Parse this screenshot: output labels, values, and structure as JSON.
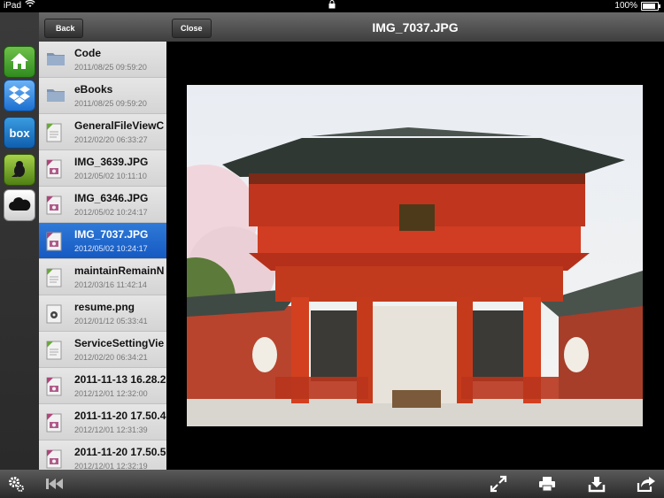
{
  "statusbar": {
    "device": "iPad",
    "battery_percent": "100%"
  },
  "sidebar": {
    "items": [
      {
        "name": "home",
        "icon": "home-icon"
      },
      {
        "name": "dropbox",
        "icon": "dropbox-icon"
      },
      {
        "name": "box",
        "label": "box",
        "icon": "box-icon"
      },
      {
        "name": "sugarsync",
        "icon": "sugarsync-icon"
      },
      {
        "name": "cloud",
        "icon": "cloud-icon"
      }
    ]
  },
  "filepanel": {
    "back_label": "Back",
    "files": [
      {
        "name": "Code",
        "date": "2011/08/25 09:59:20",
        "type": "folder"
      },
      {
        "name": "eBooks",
        "date": "2011/08/25 09:59:20",
        "type": "folder"
      },
      {
        "name": "GeneralFileViewC",
        "date": "2012/02/20 06:33:27",
        "type": "doc"
      },
      {
        "name": "IMG_3639.JPG",
        "date": "2012/05/02 10:11:10",
        "type": "image"
      },
      {
        "name": "IMG_6346.JPG",
        "date": "2012/05/02 10:24:17",
        "type": "image"
      },
      {
        "name": "IMG_7037.JPG",
        "date": "2012/05/02 10:24:17",
        "type": "image",
        "selected": true
      },
      {
        "name": "maintainRemainN",
        "date": "2012/03/16 11:42:14",
        "type": "doc"
      },
      {
        "name": "resume.png",
        "date": "2012/01/12 05:33:41",
        "type": "png"
      },
      {
        "name": "ServiceSettingVie",
        "date": "2012/02/20 06:34:21",
        "type": "doc"
      },
      {
        "name": "2011-11-13 16.28.2",
        "date": "2012/12/01 12:32:00",
        "type": "image"
      },
      {
        "name": "2011-11-20 17.50.4",
        "date": "2012/12/01 12:31:39",
        "type": "image"
      },
      {
        "name": "2011-11-20 17.50.5",
        "date": "2012/12/01 12:32:19",
        "type": "image"
      }
    ]
  },
  "viewer": {
    "close_label": "Close",
    "title": "IMG_7037.JPG"
  },
  "toolbar": {
    "icons": [
      "settings-icon",
      "rewind-icon",
      "fullscreen-icon",
      "print-icon",
      "save-icon",
      "share-icon"
    ]
  }
}
